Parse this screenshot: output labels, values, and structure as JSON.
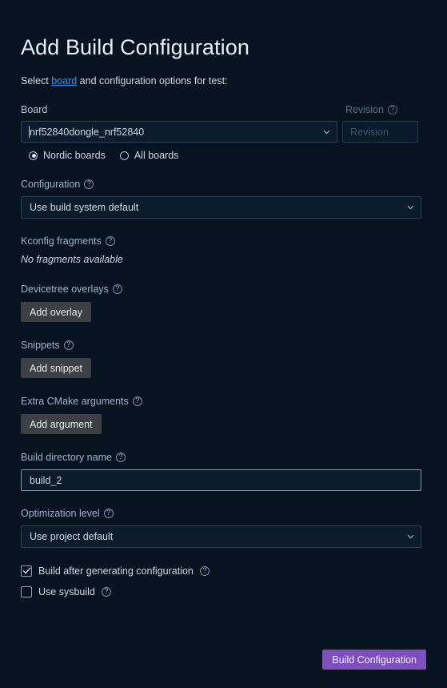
{
  "page": {
    "title": "Add Build Configuration",
    "subtitle_prefix": "Select ",
    "subtitle_link": "board",
    "subtitle_suffix": " and configuration options for test:",
    "background_color": "#071320",
    "accent_color": "#7d4fbd",
    "link_color": "#3a96e8"
  },
  "board": {
    "label": "Board",
    "value": "nrf52840dongle_nrf52840",
    "help": "?",
    "radios": [
      {
        "label": "Nordic boards",
        "selected": true
      },
      {
        "label": "All boards",
        "selected": false
      }
    ]
  },
  "revision": {
    "label": "Revision",
    "placeholder": "Revision",
    "value": "",
    "help": "?",
    "disabled": true
  },
  "configuration": {
    "label": "Configuration",
    "help": "?",
    "value": "Use build system default",
    "options": [
      "Use build system default"
    ]
  },
  "kconfig": {
    "label": "Kconfig fragments",
    "help": "?",
    "empty_text": "No fragments available"
  },
  "devicetree": {
    "label": "Devicetree overlays",
    "help": "?",
    "button": "Add overlay"
  },
  "snippets": {
    "label": "Snippets",
    "help": "?",
    "button": "Add snippet"
  },
  "cmake": {
    "label": "Extra CMake arguments",
    "help": "?",
    "button": "Add argument"
  },
  "build_dir": {
    "label": "Build directory name",
    "help": "?",
    "value": "build_2"
  },
  "optimization": {
    "label": "Optimization level",
    "help": "?",
    "value": "Use project default",
    "options": [
      "Use project default"
    ]
  },
  "checkboxes": [
    {
      "label": "Build after generating configuration",
      "checked": true,
      "help": "?"
    },
    {
      "label": "Use sysbuild",
      "checked": false,
      "help": "?"
    }
  ],
  "footer": {
    "submit_label": "Build Configuration"
  }
}
